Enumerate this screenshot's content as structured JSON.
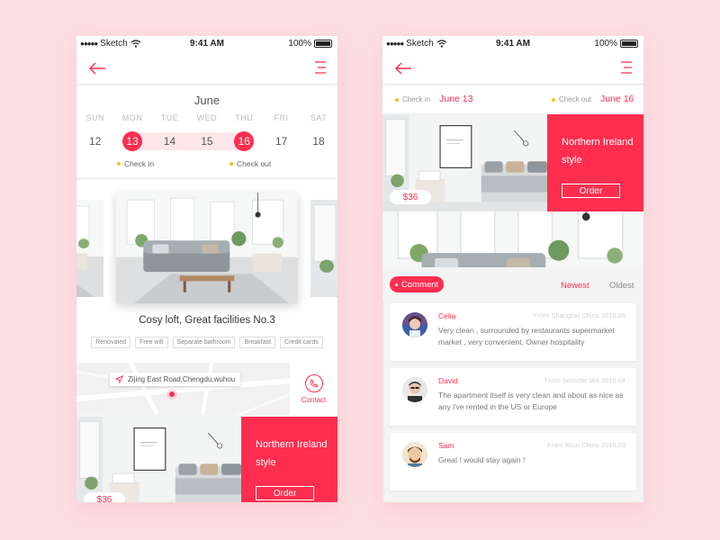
{
  "status_bar": {
    "signal": "●●●●●",
    "carrier": "Sketch",
    "time": "9:41 AM",
    "battery": "100%"
  },
  "left_screen": {
    "calendar": {
      "month": "June",
      "weekdays": [
        "SUN",
        "MON",
        "TUE",
        "WED",
        "THU",
        "FRI",
        "SAT"
      ],
      "dates": [
        "12",
        "13",
        "14",
        "15",
        "16",
        "17",
        "18"
      ],
      "check_in_label": "Check in",
      "check_out_label": "Check out"
    },
    "listing": {
      "title": "Cosy loft, Great facilities No.3",
      "tags": [
        "Renovated",
        "Free wifi",
        "Separate bathroom",
        "Breakfast",
        "Credit cards"
      ]
    },
    "map": {
      "address": "Zijing East Road,Chengdu,wuhou",
      "contact_label": "Contact"
    },
    "offer": {
      "title": "Northern Ireland style",
      "order_label": "Order",
      "price": "$36"
    }
  },
  "right_screen": {
    "check_in_label": "Check in",
    "check_in_date": "June 13",
    "check_out_label": "Check out",
    "check_out_date": "June 16",
    "offer": {
      "title": "Northern Ireland style",
      "order_label": "Order",
      "price": "$36"
    },
    "comment_tab": "Comment",
    "sort_newest": "Newest",
    "sort_oldest": "Oldest",
    "comments": [
      {
        "name": "Celia",
        "meta": "From Shanghai China  2016.06",
        "text": "Very clean , surrounded by restaurants supermarket market , very convenient. Owner hospitality"
      },
      {
        "name": "David",
        "meta": "From Seeuttle WA  2015.04",
        "text": "The apartment itself is very clean and about as nice as any i've rented in the US or Europe"
      },
      {
        "name": "Sam",
        "meta": "From Wuxi China  2015.03",
        "text": "Great ! would stay again !"
      }
    ]
  },
  "colors": {
    "accent": "#ff2e4f",
    "background": "#fcdfe2",
    "range_highlight": "#fde7ea",
    "legend_dot": "#f6c31c"
  },
  "icons": {
    "back": "arrow-left-icon",
    "menu": "hamburger-menu-icon",
    "location": "location-arrow-icon",
    "phone": "phone-icon",
    "wifi": "wifi-icon",
    "battery": "battery-icon"
  }
}
